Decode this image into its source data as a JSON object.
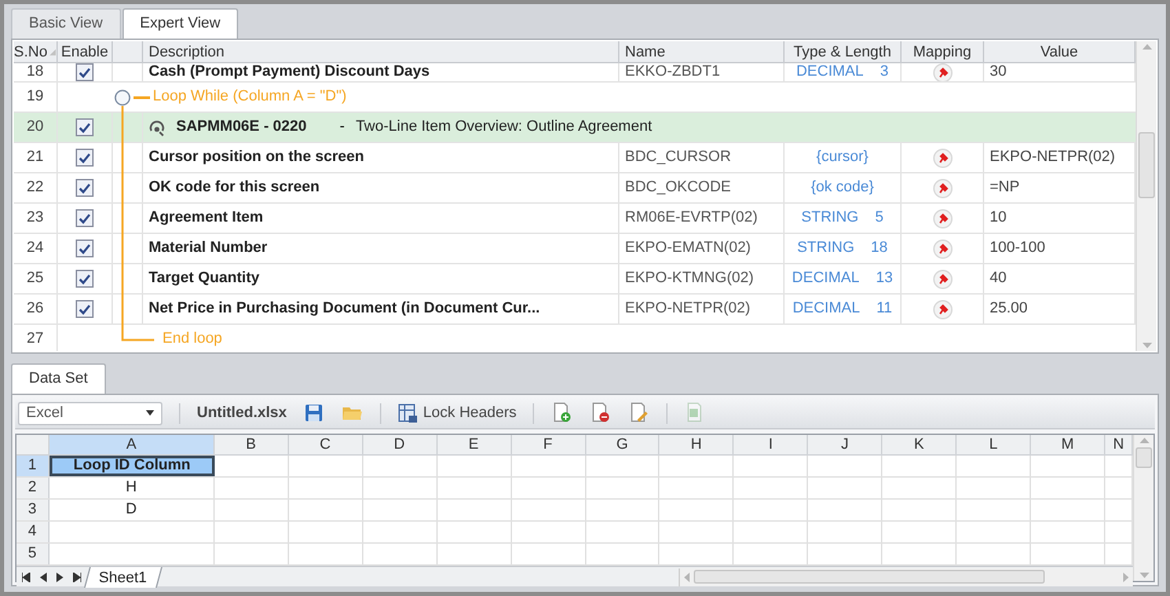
{
  "tabs": [
    {
      "label": "Basic View",
      "selected": false
    },
    {
      "label": "Expert View",
      "selected": true
    }
  ],
  "grid": {
    "columns": [
      "S.No",
      "Enable",
      "Description",
      "Name",
      "Type & Length",
      "Mapping",
      "Value"
    ],
    "rows": [
      {
        "kind": "field",
        "sno": "18",
        "enabled": true,
        "description": "Cash (Prompt Payment) Discount Days",
        "name": "EKKO-ZBDT1",
        "type": "DECIMAL",
        "length": "3",
        "value": "30"
      },
      {
        "kind": "loop_start",
        "sno": "19",
        "text": "Loop While (Column A = \"D\")"
      },
      {
        "kind": "screen",
        "sno": "20",
        "enabled": true,
        "program": "SAPMM06E - 0220",
        "separator": "-",
        "title": "Two-Line Item Overview: Outline Agreement"
      },
      {
        "kind": "field",
        "sno": "21",
        "enabled": true,
        "description": "Cursor position on the screen",
        "name": "BDC_CURSOR",
        "type": "{cursor}",
        "value": "EKPO-NETPR(02)"
      },
      {
        "kind": "field",
        "sno": "22",
        "enabled": true,
        "description": "OK code for this screen",
        "name": "BDC_OKCODE",
        "type": "{ok code}",
        "value": "=NP"
      },
      {
        "kind": "field",
        "sno": "23",
        "enabled": true,
        "description": "Agreement Item",
        "name": "RM06E-EVRTP(02)",
        "type": "STRING",
        "length": "5",
        "value": "10"
      },
      {
        "kind": "field",
        "sno": "24",
        "enabled": true,
        "description": "Material Number",
        "name": "EKPO-EMATN(02)",
        "type": "STRING",
        "length": "18",
        "value": "100-100"
      },
      {
        "kind": "field",
        "sno": "25",
        "enabled": true,
        "description": "Target Quantity",
        "name": "EKPO-KTMNG(02)",
        "type": "DECIMAL",
        "length": "13",
        "value": "40"
      },
      {
        "kind": "field",
        "sno": "26",
        "enabled": true,
        "description": "Net Price in Purchasing Document (in Document Cur...",
        "name": "EKPO-NETPR(02)",
        "type": "DECIMAL",
        "length": "11",
        "value": "25.00"
      },
      {
        "kind": "loop_end",
        "sno": "27",
        "text": "End loop"
      }
    ]
  },
  "data_set": {
    "tabs": [
      {
        "label": "Data Set",
        "selected": true
      }
    ],
    "source": "Excel",
    "file": "Untitled.xlsx",
    "lock_headers": "Lock Headers",
    "columns": [
      {
        "label": "A",
        "selected": true
      },
      {
        "label": "B",
        "selected": false
      },
      {
        "label": "C",
        "selected": false
      },
      {
        "label": "D",
        "selected": false
      },
      {
        "label": "E",
        "selected": false
      },
      {
        "label": "F",
        "selected": false
      },
      {
        "label": "G",
        "selected": false
      },
      {
        "label": "H",
        "selected": false
      },
      {
        "label": "I",
        "selected": false
      },
      {
        "label": "J",
        "selected": false
      },
      {
        "label": "K",
        "selected": false
      },
      {
        "label": "L",
        "selected": false
      },
      {
        "label": "M",
        "selected": false
      },
      {
        "label": "N",
        "selected": false
      }
    ],
    "rows": [
      {
        "label": "1",
        "selected": true,
        "cell_a": {
          "text": "Loop ID Column",
          "bold": true,
          "selected": true
        }
      },
      {
        "label": "2",
        "selected": false,
        "cell_a": {
          "text": "H",
          "bold": false,
          "selected": false
        }
      },
      {
        "label": "3",
        "selected": false,
        "cell_a": {
          "text": "D",
          "bold": false,
          "selected": false
        }
      },
      {
        "label": "4",
        "selected": false
      },
      {
        "label": "5",
        "selected": false
      }
    ],
    "sheet_tabs": [
      {
        "label": "Sheet1",
        "selected": true
      }
    ]
  }
}
